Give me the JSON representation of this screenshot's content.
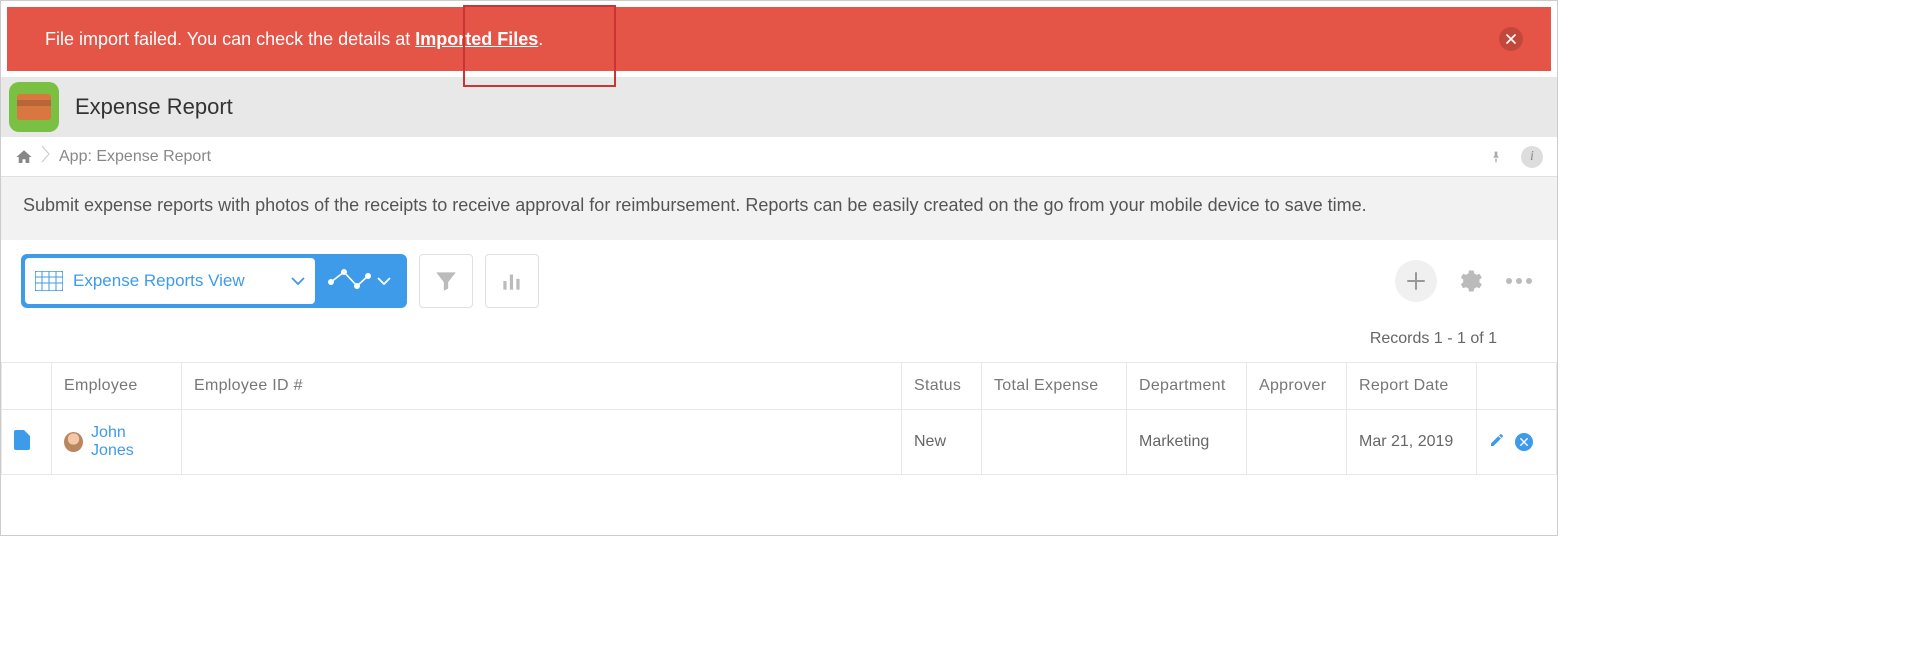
{
  "alert": {
    "message_prefix": "File import failed. You can check the details at ",
    "link_text": "Imported Files",
    "message_suffix": "."
  },
  "app": {
    "title": "Expense Report"
  },
  "breadcrumb": {
    "text": "App: Expense Report"
  },
  "description": "Submit expense reports with photos of the receipts to receive approval for reimbursement. Reports can be easily created on the go from your mobile device to save time.",
  "toolbar": {
    "view_name": "Expense Reports View"
  },
  "records": {
    "label": "Records 1 - 1 of 1"
  },
  "table": {
    "headers": {
      "employee": "Employee",
      "employee_id": "Employee ID #",
      "status": "Status",
      "total_expense": "Total Expense",
      "department": "Department",
      "approver": "Approver",
      "report_date": "Report Date"
    },
    "rows": [
      {
        "employee": "John Jones",
        "employee_id": "",
        "status": "New",
        "total_expense": "",
        "department": "Marketing",
        "approver": "",
        "report_date": "Mar 21, 2019"
      }
    ]
  }
}
